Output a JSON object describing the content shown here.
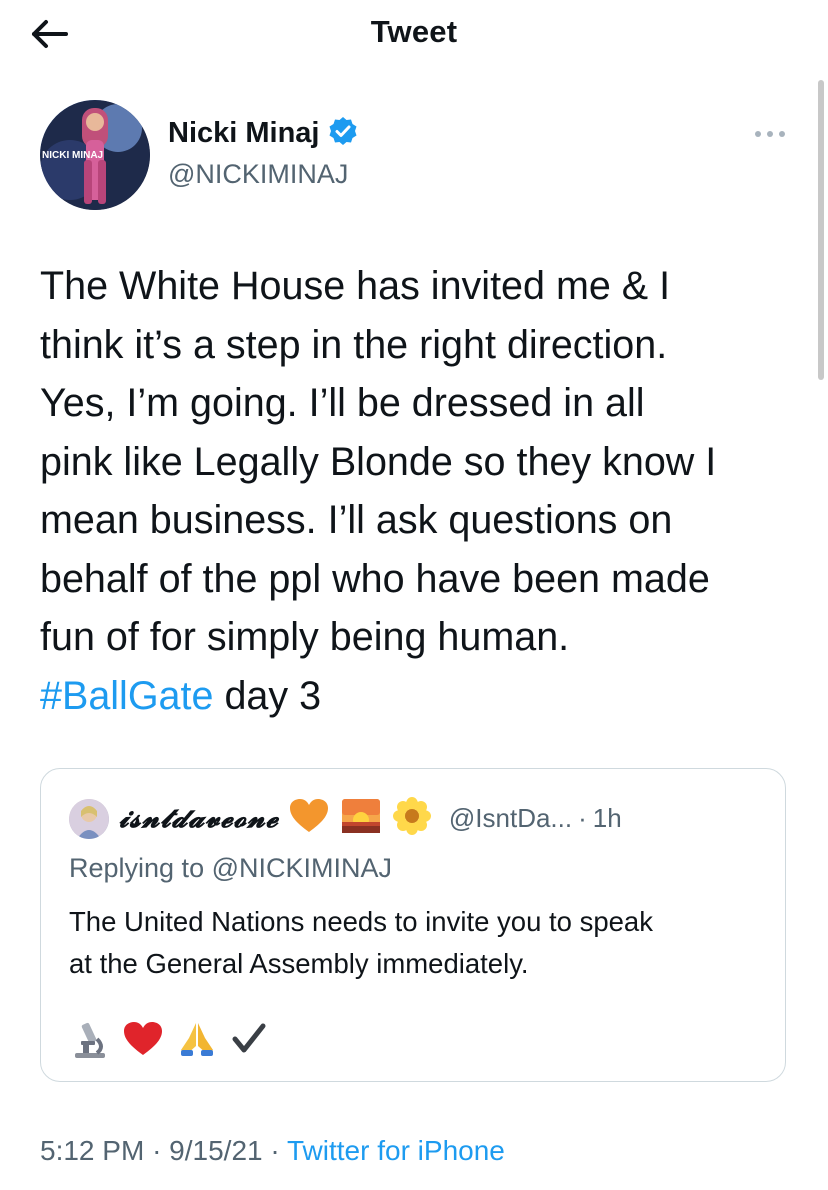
{
  "header": {
    "title": "Tweet",
    "back_icon": "arrow-left-icon"
  },
  "tweet": {
    "author": {
      "name": "Nicki Minaj",
      "handle": "@NICKIMINAJ",
      "verified": true,
      "avatar_caption": "NICKI MINAJ"
    },
    "text_lines": [
      "The White House has invited me & I",
      "think it’s a step in the right direction.",
      "Yes, I’m going. I’ll be dressed in all",
      "pink like Legally Blonde so they know I",
      "mean business. I’ll ask questions on",
      "behalf of the ppl who have been made",
      "fun of for simply being human."
    ],
    "hashtag": "#BallGate",
    "hashtag_suffix": " day 3",
    "timestamp": "5:12 PM",
    "separator": "·",
    "date": "9/15/21",
    "source": "Twitter for iPhone"
  },
  "quote": {
    "display_name": "𝓲𝓼𝓷𝓽𝓭𝓪𝓿𝓮𝓸𝓷𝓮",
    "name_emojis": [
      "orange-heart-icon",
      "sunrise-icon",
      "daisy-flower-icon"
    ],
    "handle": "@IsntDa...",
    "separator": "·",
    "time": "1h",
    "replying_to": "Replying to @NICKIMINAJ",
    "text_lines": [
      "The United Nations needs to invite you to speak",
      "at the General Assembly immediately."
    ],
    "trailing_emojis": [
      "microscope-icon",
      "red-heart-icon",
      "praying-hands-icon",
      "checkmark-icon"
    ]
  },
  "colors": {
    "accent": "#1d9bf0",
    "muted": "#536471",
    "text": "#0f1419",
    "border": "#cfd9de"
  }
}
